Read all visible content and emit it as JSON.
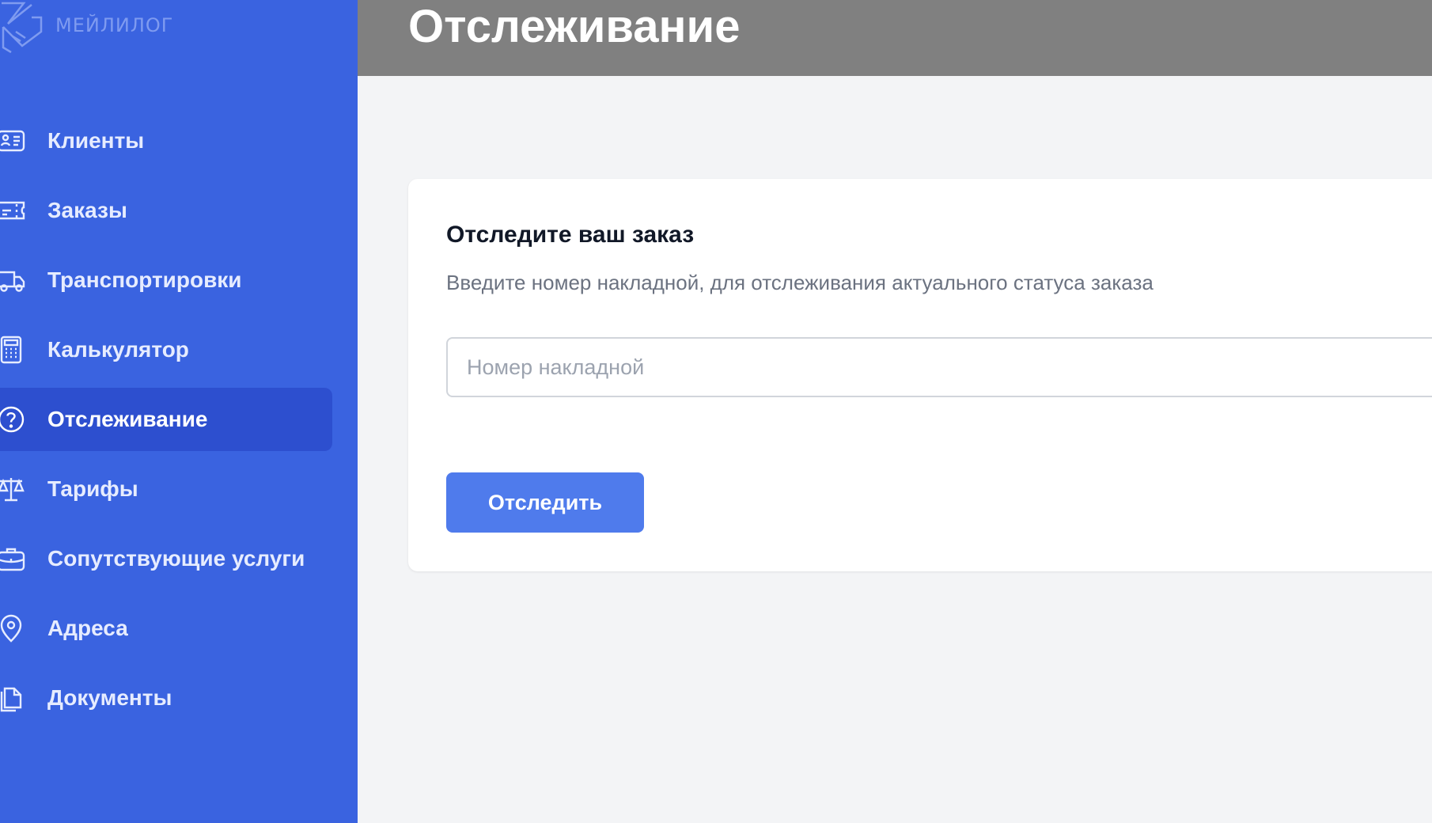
{
  "brand": {
    "name": "МЕЙЛИЛОГ",
    "logo_icon": "handshake-envelope-icon"
  },
  "sidebar": {
    "items": [
      {
        "label": "Клиенты",
        "icon": "id-card-icon",
        "active": false
      },
      {
        "label": "Заказы",
        "icon": "ticket-icon",
        "active": false
      },
      {
        "label": "Транспортировки",
        "icon": "truck-icon",
        "active": false
      },
      {
        "label": "Калькулятор",
        "icon": "calculator-icon",
        "active": false
      },
      {
        "label": "Отслеживание",
        "icon": "question-circle-icon",
        "active": true
      },
      {
        "label": "Тарифы",
        "icon": "scales-icon",
        "active": false
      },
      {
        "label": "Сопутствующие услуги",
        "icon": "briefcase-icon",
        "active": false
      },
      {
        "label": "Адреса",
        "icon": "map-pin-icon",
        "active": false
      },
      {
        "label": "Документы",
        "icon": "documents-icon",
        "active": false
      }
    ]
  },
  "header": {
    "title": "Отслеживание"
  },
  "tracking": {
    "title": "Отследите ваш заказ",
    "description": "Введите номер накладной, для отслеживания актуального статуса заказа",
    "input_placeholder": "Номер накладной",
    "input_value": "",
    "button_label": "Отследить"
  },
  "colors": {
    "sidebar_bg": "#3a63e0",
    "sidebar_active": "#2d4fcf",
    "header_bg": "#808080",
    "button_bg": "#4f7bec",
    "page_bg": "#f3f4f6"
  }
}
